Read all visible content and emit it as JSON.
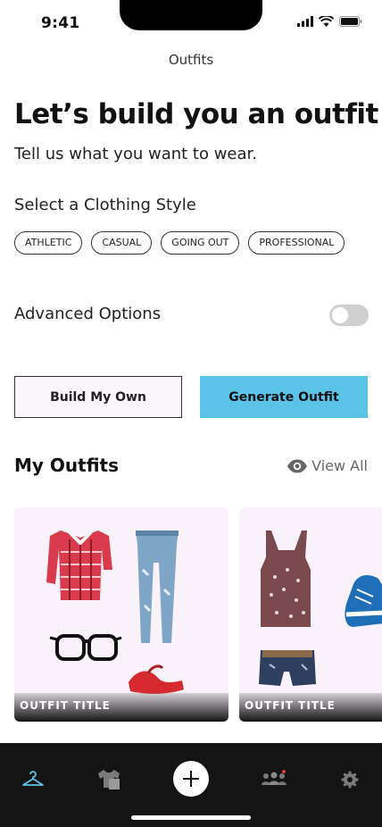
{
  "status_bar": {
    "time": "9:41"
  },
  "nav": {
    "title": "Outfits"
  },
  "hero": {
    "title": "Let’s build you an outfit!",
    "subtitle": "Tell us what you want to wear."
  },
  "style_section": {
    "label": "Select a Clothing Style",
    "chips": [
      "ATHLETIC",
      "CASUAL",
      "GOING OUT",
      "PROFESSIONAL"
    ]
  },
  "advanced": {
    "label": "Advanced Options",
    "enabled": false
  },
  "actions": {
    "build_own": "Build My Own",
    "generate": "Generate Outfit"
  },
  "my_outfits": {
    "heading": "My Outfits",
    "view_all": "View All",
    "cards": [
      {
        "title": "OUTFIT TITLE"
      },
      {
        "title": "OUTFIT TITLE"
      }
    ]
  },
  "tab_bar": {
    "items": [
      "hanger-icon",
      "shirt-icon",
      "add-icon",
      "community-icon",
      "settings-icon"
    ],
    "active_color": "#5bc3e8"
  },
  "colors": {
    "accent": "#5bc3e8",
    "card_bg": "#f9f2fa",
    "notification_dot": "#e53935"
  }
}
